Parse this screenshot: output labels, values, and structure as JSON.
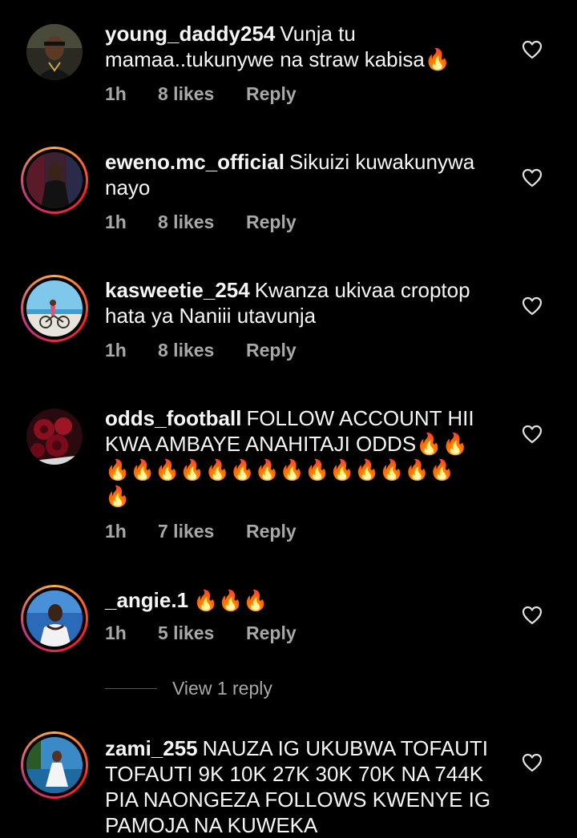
{
  "colors": {
    "background": "#000000",
    "text": "#f5f5f5",
    "meta": "#a8a8a8"
  },
  "comments": [
    {
      "username": "young_daddy254",
      "text": "Vunja tu mamaa..tukunywe na straw kabisa🔥",
      "time": "1h",
      "likes": "8 likes",
      "reply": "Reply"
    },
    {
      "username": "eweno.mc_official",
      "text": "Sikuizi kuwakunywa nayo",
      "time": "1h",
      "likes": "8 likes",
      "reply": "Reply"
    },
    {
      "username": "kasweetie_254",
      "text": "Kwanza ukivaa croptop hata ya Naniii utavunja",
      "time": "1h",
      "likes": "8 likes",
      "reply": "Reply"
    },
    {
      "username": "odds_football",
      "text": "FOLLOW ACCOUNT HII KWA AMBAYE ANAHITAJI ODDS🔥🔥",
      "emoji_line": "🔥🔥🔥🔥🔥🔥🔥🔥🔥🔥🔥🔥🔥🔥",
      "emoji_line2": "🔥",
      "time": "1h",
      "likes": "7 likes",
      "reply": "Reply"
    },
    {
      "username": "_angie.1",
      "text": "🔥🔥🔥",
      "time": "1h",
      "likes": "5 likes",
      "reply": "Reply"
    },
    {
      "username": "zami_255",
      "text": "NAUZA IG UKUBWA TOFAUTI TOFAUTI  9K 10K 27K 30K 70K NA 744K PIA NAONGEZA FOLLOWS KWENYE IG PAMOJA NA KUWEKA"
    }
  ],
  "view_replies": "View 1 reply",
  "icons": {
    "like": "heart-outline-icon"
  }
}
